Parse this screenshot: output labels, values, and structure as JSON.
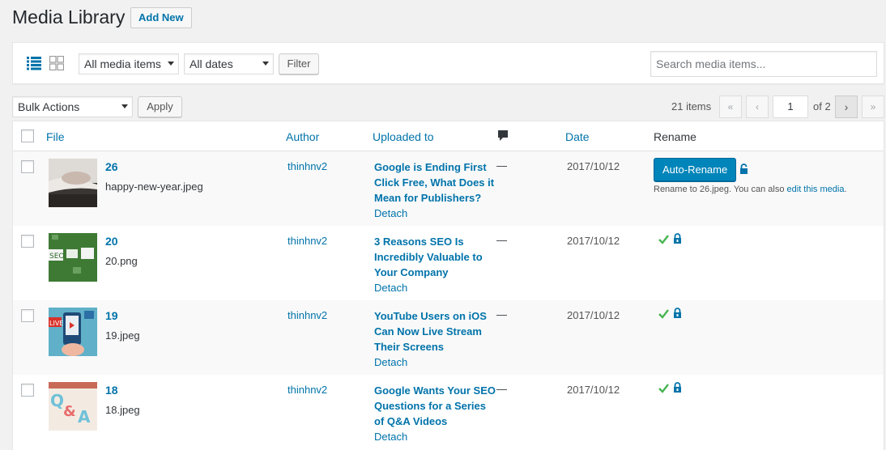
{
  "header": {
    "title": "Media Library",
    "add_new": "Add New"
  },
  "filters": {
    "media_type": "All media items",
    "dates": "All dates",
    "filter_button": "Filter",
    "search_placeholder": "Search media items..."
  },
  "tablenav": {
    "bulk_actions": "Bulk Actions",
    "apply": "Apply",
    "items_count": "21 items",
    "first": "«",
    "prev": "‹",
    "current_page": "1",
    "of_pages": "of 2",
    "next": "›",
    "last": "»"
  },
  "columns": {
    "file": "File",
    "author": "Author",
    "uploaded_to": "Uploaded to",
    "comments_icon": "comment-icon",
    "date": "Date",
    "rename": "Rename"
  },
  "rows": [
    {
      "title": "26",
      "filename": "happy-new-year.jpeg",
      "author": "thinhnv2",
      "uploaded_to": "Google is Ending First Click Free, What Does it Mean for Publishers?",
      "detach": "Detach",
      "comments": "—",
      "date": "2017/10/12",
      "rename_button": "Auto-Rename",
      "rename_note_prefix": "Rename to 26.jpeg. You can also ",
      "rename_note_link": "edit this media",
      "rename_note_suffix": "."
    },
    {
      "title": "20",
      "filename": "20.png",
      "author": "thinhnv2",
      "uploaded_to": "3 Reasons SEO Is Incredibly Valuable to Your Company",
      "detach": "Detach",
      "comments": "—",
      "date": "2017/10/12"
    },
    {
      "title": "19",
      "filename": "19.jpeg",
      "author": "thinhnv2",
      "uploaded_to": "YouTube Users on iOS Can Now Live Stream Their Screens",
      "detach": "Detach",
      "comments": "—",
      "date": "2017/10/12"
    },
    {
      "title": "18",
      "filename": "18.jpeg",
      "author": "thinhnv2",
      "uploaded_to": "Google Wants Your SEO Questions for a Series of Q&A Videos",
      "detach": "Detach",
      "comments": "—",
      "date": "2017/10/12"
    }
  ],
  "colors": {
    "link": "#0073aa",
    "primary_button": "#0085ba",
    "check": "#46b450",
    "lock": "#0073aa"
  }
}
